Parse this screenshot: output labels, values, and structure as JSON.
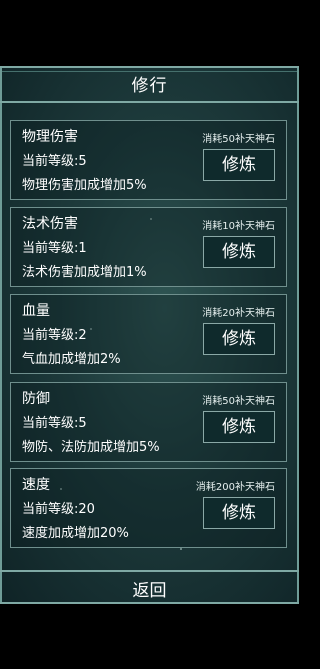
{
  "header": {
    "title": "修行"
  },
  "cards": [
    {
      "name": "物理伤害",
      "level": "当前等级:5",
      "effect": "物理伤害加成增加5%",
      "cost": "消耗50补天神石",
      "button": "修炼"
    },
    {
      "name": "法术伤害",
      "level": "当前等级:1",
      "effect": "法术伤害加成增加1%",
      "cost": "消耗10补天神石",
      "button": "修炼"
    },
    {
      "name": "血量",
      "level": "当前等级:2",
      "effect": "气血加成增加2%",
      "cost": "消耗20补天神石",
      "button": "修炼"
    },
    {
      "name": "防御",
      "level": "当前等级:5",
      "effect": "物防、法防加成增加5%",
      "cost": "消耗50补天神石",
      "button": "修炼"
    },
    {
      "name": "速度",
      "level": "当前等级:20",
      "effect": "速度加成增加20%",
      "cost": "消耗200补天神石",
      "button": "修炼"
    }
  ],
  "footer": {
    "back_label": "返回"
  }
}
